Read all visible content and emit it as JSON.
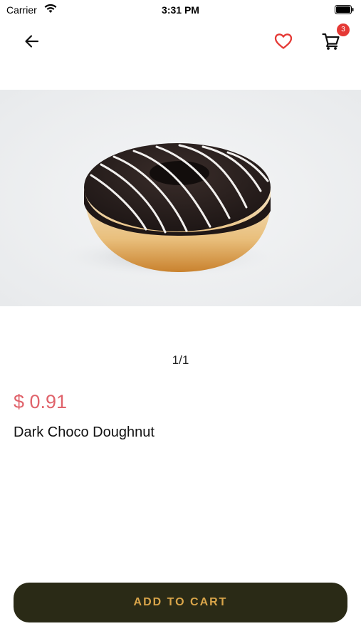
{
  "status_bar": {
    "carrier": "Carrier",
    "time": "3:31 PM"
  },
  "app_bar": {
    "back_icon": "arrow-left",
    "favorite_icon": "heart-outline",
    "cart_icon": "shopping-cart",
    "cart_count": "3"
  },
  "product": {
    "image_icon": "chocolate-doughnut-photo",
    "pager": "1/1",
    "price": "$ 0.91",
    "name": "Dark Choco Doughnut"
  },
  "actions": {
    "add_to_cart_label": "ADD TO CART"
  },
  "colors": {
    "price": "#e0636b",
    "favorite": "#e53935",
    "badge": "#e53935",
    "button_bg": "#2a2a16",
    "button_text": "#d9a54a"
  }
}
